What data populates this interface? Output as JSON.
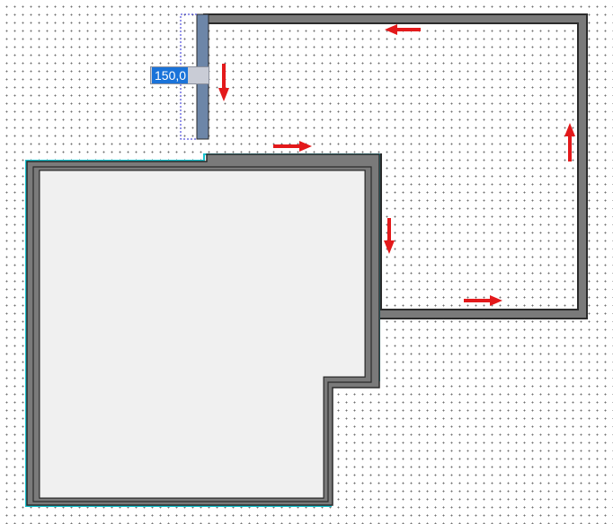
{
  "dimension_input": {
    "value": "150,0"
  },
  "colors": {
    "wall": "#7a7a7a",
    "wall_outline": "#2b2b2b",
    "room_floor": "#f0f0f0",
    "selection_outline": "#18c3cf",
    "active_wall": "#6d86a8",
    "arrow": "#e3191b",
    "guide_line": "#2a2ad6"
  },
  "icons": {
    "direction_arrows": [
      "arrow-left-icon",
      "arrow-right-icon",
      "arrow-right-icon",
      "arrow-right-icon",
      "arrow-down-icon",
      "arrow-down-icon",
      "arrow-up-icon"
    ]
  }
}
